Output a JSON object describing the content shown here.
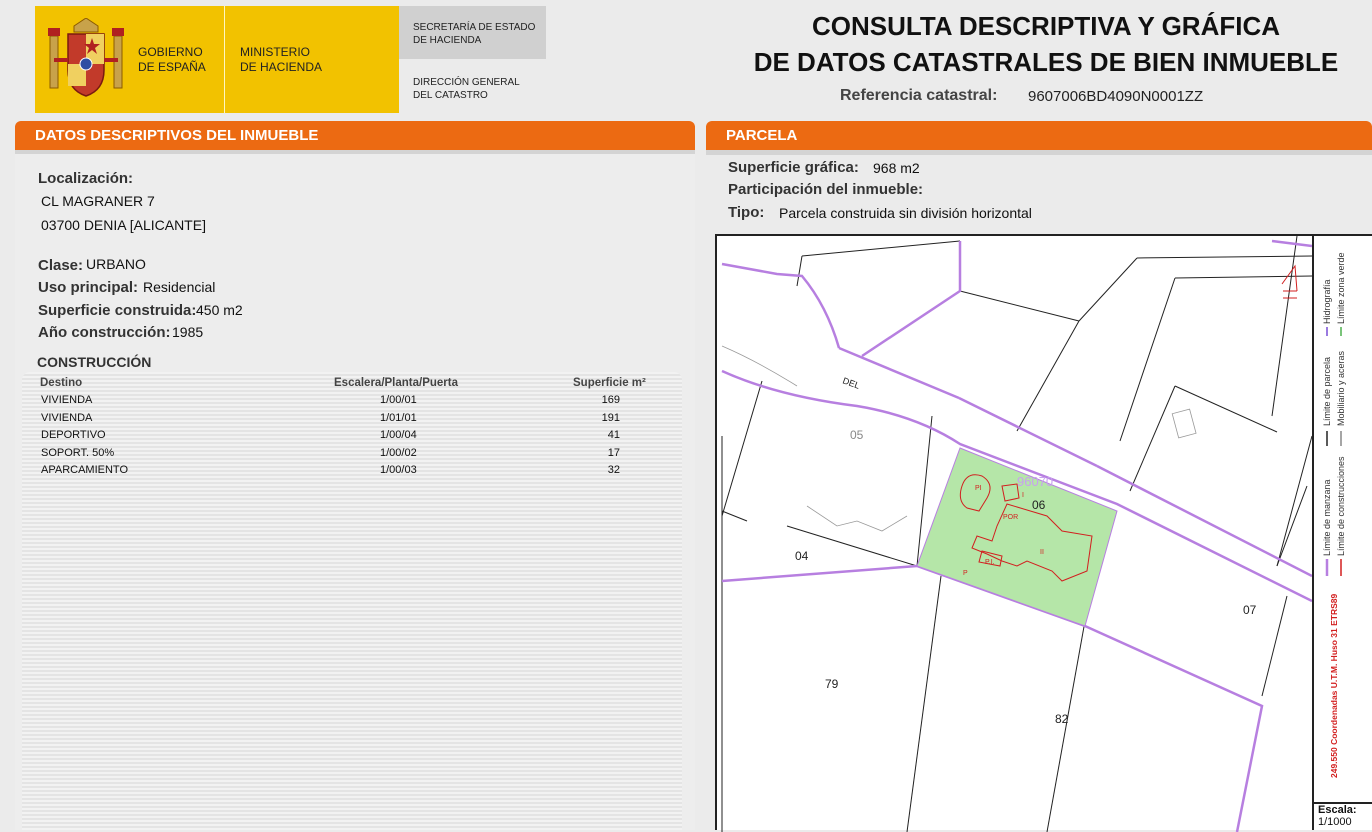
{
  "header": {
    "gobierno": [
      "GOBIERNO",
      "DE ESPAÑA"
    ],
    "ministerio": [
      "MINISTERIO",
      "DE HACIENDA"
    ],
    "secretaria": [
      "SECRETARÍA DE ESTADO",
      "DE HACIENDA"
    ],
    "direccion": [
      "DIRECCIÓN GENERAL",
      "DEL CATASTRO"
    ],
    "title_line1": "CONSULTA DESCRIPTIVA Y GRÁFICA",
    "title_line2": "DE DATOS CATASTRALES DE BIEN INMUEBLE",
    "ref_label": "Referencia catastral:",
    "ref_value": "9607006BD4090N0001ZZ"
  },
  "left": {
    "section_title": "DATOS DESCRIPTIVOS DEL INMUEBLE",
    "localizacion_label": "Localización:",
    "address1": "CL MAGRANER 7",
    "address2": "03700 DENIA [ALICANTE]",
    "clase_label": "Clase:",
    "clase_value": "URBANO",
    "uso_label": "Uso principal:",
    "uso_value": "Residencial",
    "sup_label": "Superficie construida:",
    "sup_value": "450 m2",
    "anio_label": "Año construcción:",
    "anio_value": "1985",
    "construccion_title": "CONSTRUCCIÓN",
    "table": {
      "headers": [
        "Destino",
        "Escalera/Planta/Puerta",
        "Superficie m²"
      ],
      "rows": [
        [
          "VIVIENDA",
          "1/00/01",
          "169"
        ],
        [
          "VIVIENDA",
          "1/01/01",
          "191"
        ],
        [
          "DEPORTIVO",
          "1/00/04",
          "41"
        ],
        [
          "SOPORT. 50%",
          "1/00/02",
          "17"
        ],
        [
          "APARCAMIENTO",
          "1/00/03",
          "32"
        ]
      ]
    }
  },
  "right": {
    "section_title": "PARCELA",
    "sup_grafica_label": "Superficie gráfica:",
    "sup_grafica_value": "968 m2",
    "participacion_label": "Participación del inmueble:",
    "participacion_value": "",
    "tipo_label": "Tipo:",
    "tipo_value": "Parcela construida sin división horizontal"
  },
  "map": {
    "labels": {
      "del": "DEL",
      "p05": "05",
      "p06": "06",
      "p04": "04",
      "p07": "07",
      "p79": "79",
      "p82": "82",
      "block": "96070",
      "pi": "PI",
      "i": "I",
      "por": "POR",
      "ii": "II",
      "p": "P",
      "pi2": "P.I."
    },
    "legend": {
      "hidrografia": "Hidrografía",
      "zona_verde": "Límite zona verde",
      "limite_parcela": "Límite de parcela",
      "mobiliario": "Mobiliario y aceras",
      "limite_manzana": "Límite de manzana",
      "limite_construcciones": "Límite de construcciones",
      "coordenadas": "249.550 Coordenadas U.T.M. Huso 31 ETRS89"
    },
    "scale_label": "Escala:",
    "scale_value": "1/1000",
    "colors": {
      "manzana": "#b77fe0",
      "parcel_fill": "#b5e6a8",
      "building": "#d21f1f"
    }
  }
}
